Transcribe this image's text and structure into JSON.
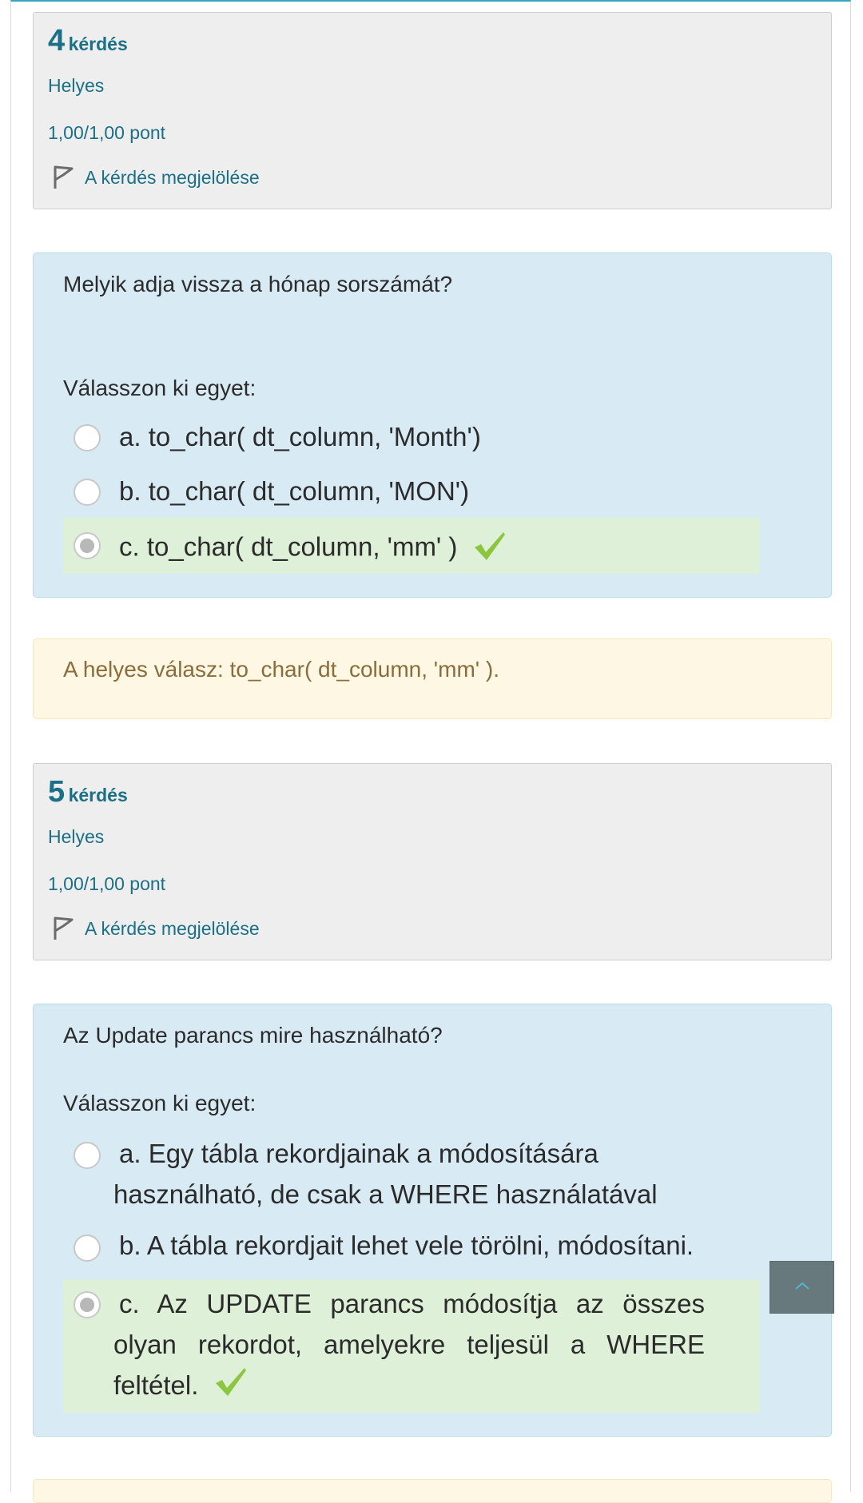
{
  "questions": [
    {
      "number": "4",
      "word": "kérdés",
      "state": "Helyes",
      "grade": "1,00/1,00 pont",
      "flag_label": "A kérdés megjelölése",
      "text": "Melyik adja vissza a hónap sorszámát?",
      "prompt": "Válasszon ki egyet:",
      "options": [
        {
          "label": "a. to_char( dt_column, 'Month')",
          "selected": false,
          "correct": false
        },
        {
          "label": "b. to_char( dt_column, 'MON')",
          "selected": false,
          "correct": false
        },
        {
          "label": "c. to_char( dt_column, 'mm' )",
          "selected": true,
          "correct": true
        }
      ],
      "right_answer": "A helyes válasz: to_char( dt_column, 'mm' )."
    },
    {
      "number": "5",
      "word": "kérdés",
      "state": "Helyes",
      "grade": "1,00/1,00 pont",
      "flag_label": "A kérdés megjelölése",
      "text": "Az Update parancs mire használható?",
      "prompt": "Válasszon ki egyet:",
      "options": [
        {
          "label": "a. Egy tábla rekordjainak a módosítására használható, de csak a WHERE használatával",
          "selected": false,
          "correct": false
        },
        {
          "label": "b. A tábla rekordjait lehet vele törölni, módosítani.",
          "selected": false,
          "correct": false
        },
        {
          "label": "c. Az UPDATE parancs módosítja az összes olyan rekordot, amelyekre teljesül a WHERE feltétel.",
          "selected": true,
          "correct": true
        }
      ]
    }
  ],
  "icons": {
    "flag": "flag-icon",
    "check": "check-icon",
    "back_to_top": "chevron-up-icon"
  },
  "colors": {
    "accent": "#1b6f86",
    "question_bg": "#d8ebf4",
    "correct_bg": "#dff0d8",
    "check": "#8cc63f",
    "feedback_bg": "#fdf7e3",
    "feedback_text": "#8a6d3b"
  }
}
